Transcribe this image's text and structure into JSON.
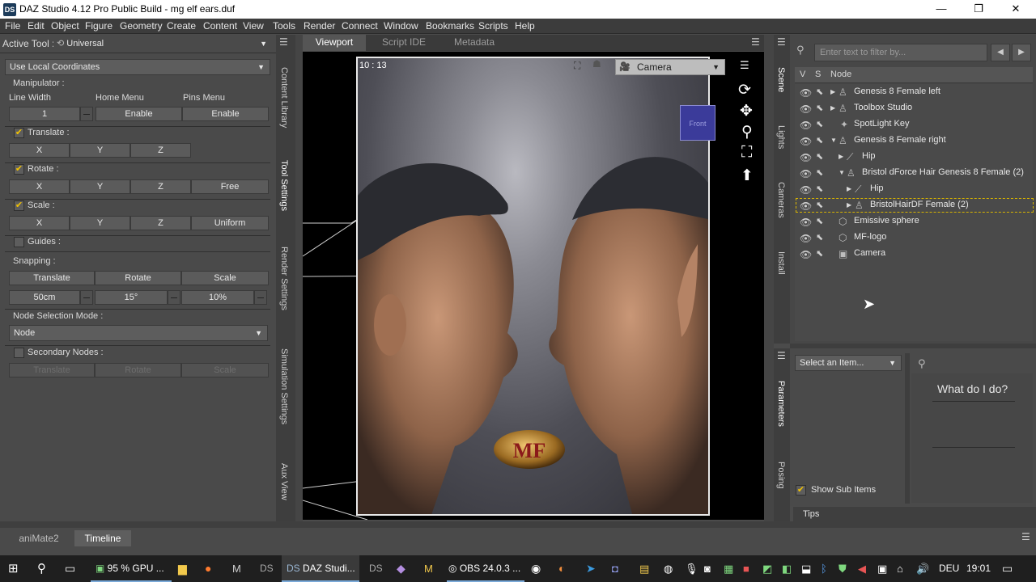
{
  "window": {
    "title": "DAZ Studio 4.12 Pro Public Build - mg elf ears.duf",
    "app_badge": "DS",
    "minimize": "—",
    "restore": "❐",
    "close": "✕"
  },
  "menu": [
    "File",
    "Edit",
    "Object",
    "Figure",
    "Geometry",
    "Create",
    "Content",
    "View",
    "Tools",
    "Render",
    "Connect",
    "Window",
    "Bookmarks",
    "Scripts",
    "Help"
  ],
  "left": {
    "active_tool_label": "Active Tool :",
    "active_tool_value": "Universal",
    "coord_mode": "Use Local Coordinates",
    "manipulator_label": "Manipulator :",
    "line_width_label": "Line Width",
    "line_width_value": "1",
    "home_menu_label": "Home Menu",
    "home_menu_value": "Enable",
    "pins_menu_label": "Pins Menu",
    "pins_menu_value": "Enable",
    "translate_label": "Translate :",
    "rotate_label": "Rotate :",
    "scale_label": "Scale :",
    "x": "X",
    "y": "Y",
    "z": "Z",
    "free": "Free",
    "uniform": "Uniform",
    "guides_label": "Guides :",
    "snapping_label": "Snapping :",
    "snap_translate": "Translate",
    "snap_rotate": "Rotate",
    "snap_scale": "Scale",
    "snap_translate_value": "50cm",
    "snap_rotate_value": "15°",
    "snap_scale_value": "10%",
    "node_sel_label": "Node Selection Mode :",
    "node_sel_value": "Node",
    "secondary_label": "Secondary Nodes :",
    "sec_translate": "Translate",
    "sec_rotate": "Rotate",
    "sec_scale": "Scale"
  },
  "left_vtabs": [
    "Content Library",
    "Tool Settings",
    "Render Settings",
    "Simulation Settings",
    "Aux View"
  ],
  "viewport": {
    "tabs": [
      "Viewport",
      "Script IDE",
      "Metadata"
    ],
    "aspect": "10 : 13",
    "camera": "Camera",
    "logo_text": "MF",
    "cube_label": "Front"
  },
  "scene": {
    "filter_placeholder": "Enter text to filter by...",
    "col_v": "V",
    "col_s": "S",
    "col_node": "Node",
    "nodes": [
      "Genesis 8 Female left",
      "Toolbox Studio",
      "SpotLight Key",
      "Genesis 8 Female right",
      "Hip",
      "Bristol dForce Hair Genesis 8 Female (2)",
      "Hip",
      "BristolHairDF Female (2)",
      "Emissive sphere",
      "MF-logo",
      "Camera"
    ]
  },
  "right_vtabs_top": [
    "Scene",
    "Lights",
    "Cameras",
    "Install"
  ],
  "right_vtabs_bottom": [
    "Parameters",
    "Posing"
  ],
  "params": {
    "select_item": "Select an Item...",
    "what_do": "What do I do?",
    "show_sub": "Show Sub Items",
    "tips": "Tips"
  },
  "bottom_tabs": [
    "aniMate2",
    "Timeline"
  ],
  "taskbar": {
    "items": [
      "95 % GPU ...",
      "DAZ Studi...",
      "OBS 24.0.3 ..."
    ],
    "lang": "DEU",
    "time": "19:01"
  }
}
